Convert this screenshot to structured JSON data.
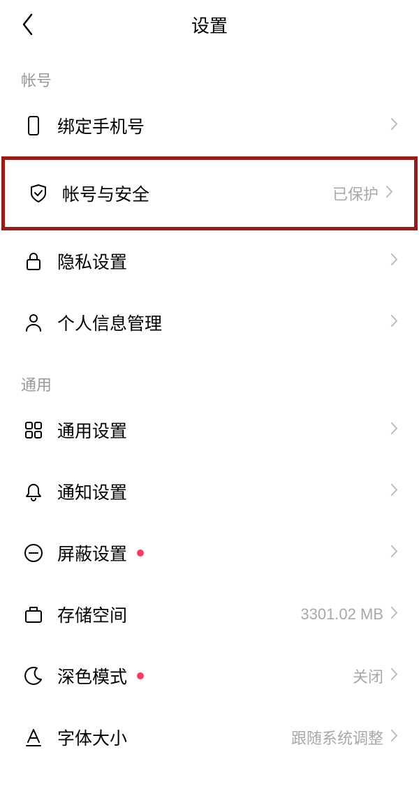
{
  "header": {
    "title": "设置"
  },
  "sections": {
    "account": {
      "title": "帐号",
      "items": {
        "bind_phone": {
          "label": "绑定手机号",
          "value": ""
        },
        "account_security": {
          "label": "帐号与安全",
          "value": "已保护"
        },
        "privacy": {
          "label": "隐私设置",
          "value": ""
        },
        "personal_info": {
          "label": "个人信息管理",
          "value": ""
        }
      }
    },
    "general": {
      "title": "通用",
      "items": {
        "general_settings": {
          "label": "通用设置",
          "value": ""
        },
        "notifications": {
          "label": "通知设置",
          "value": ""
        },
        "block": {
          "label": "屏蔽设置",
          "value": ""
        },
        "storage": {
          "label": "存储空间",
          "value": "3301.02 MB"
        },
        "dark_mode": {
          "label": "深色模式",
          "value": "关闭"
        },
        "font_size": {
          "label": "字体大小",
          "value": "跟随系统调整"
        }
      }
    }
  }
}
